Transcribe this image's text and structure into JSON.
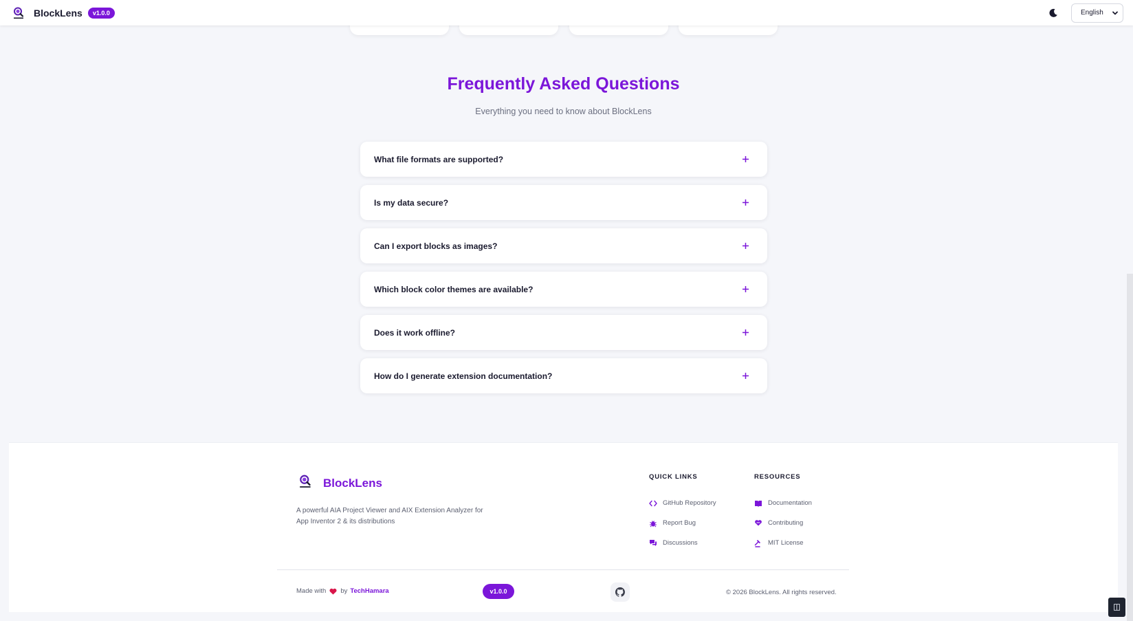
{
  "header": {
    "brand": "BlockLens",
    "version": "v1.0.0",
    "language": "English",
    "icons": {
      "logo": "magnifier-logo-icon",
      "theme": "moon-icon",
      "chevron": "chevron-down-icon"
    }
  },
  "faq": {
    "title": "Frequently Asked Questions",
    "subtitle": "Everything you need to know about BlockLens",
    "items": [
      {
        "question": "What file formats are supported?"
      },
      {
        "question": "Is my data secure?"
      },
      {
        "question": "Can I export blocks as images?"
      },
      {
        "question": "Which block color themes are available?"
      },
      {
        "question": "Does it work offline?"
      },
      {
        "question": "How do I generate extension documentation?"
      }
    ]
  },
  "footer": {
    "brand": "BlockLens",
    "description": "A powerful AIA Project Viewer and AIX Extension Analyzer for App Inventor 2 & its distributions",
    "quick_links": {
      "title": "QUICK LINKS",
      "items": [
        {
          "label": "GitHub Repository",
          "icon": "code-icon"
        },
        {
          "label": "Report Bug",
          "icon": "bug-icon"
        },
        {
          "label": "Discussions",
          "icon": "chat-icon"
        }
      ]
    },
    "resources": {
      "title": "RESOURCES",
      "items": [
        {
          "label": "Documentation",
          "icon": "book-icon"
        },
        {
          "label": "Contributing",
          "icon": "heart-hand-icon"
        },
        {
          "label": "MIT License",
          "icon": "gavel-icon"
        }
      ]
    },
    "made_with": "Made with",
    "by": "by",
    "author": "TechHamara",
    "version": "v1.0.0",
    "copyright": "© 2026 BlockLens. All rights reserved."
  },
  "colors": {
    "accent": "#7b16d9",
    "background": "#f5f6fa",
    "text": "#1a1a2e"
  }
}
